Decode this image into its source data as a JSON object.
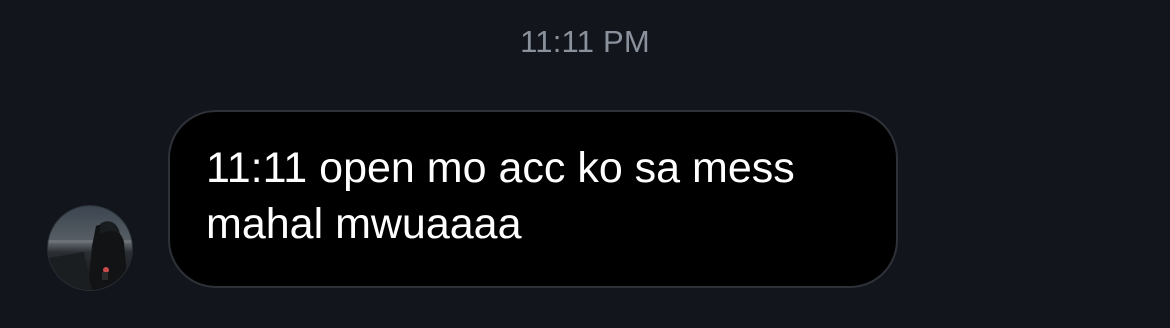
{
  "conversation": {
    "timestamp": "11:11 PM",
    "messages": [
      {
        "direction": "incoming",
        "text": "11:11 open mo acc ko sa mess\nmahal mwuaaaa",
        "avatar_icon": "user-avatar-photo"
      }
    ]
  },
  "colors": {
    "background": "#12161c",
    "bubble": "#000000",
    "bubble_border": "#2e3238",
    "text": "#ffffff",
    "timestamp": "#8a919c"
  }
}
